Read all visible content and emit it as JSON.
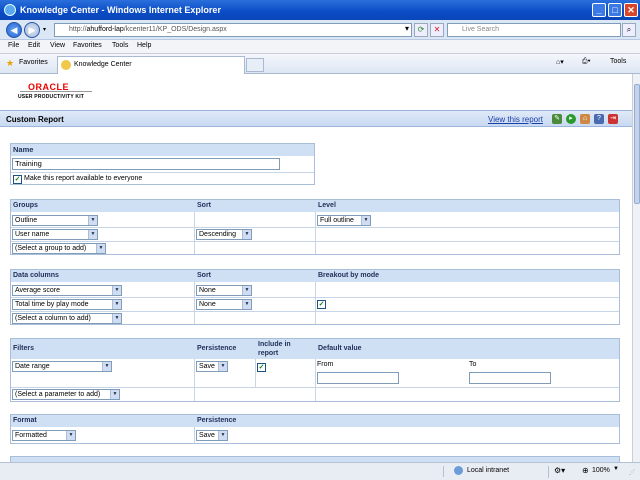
{
  "window": {
    "title": "Knowledge Center - Windows Internet Explorer"
  },
  "address": {
    "prefix": "http://",
    "host": "ahufford-lap",
    "path": "/kcenter11/KP_ODS/Design.aspx",
    "search_placeholder": "Live Search"
  },
  "menu": [
    "File",
    "Edit",
    "View",
    "Favorites",
    "Tools",
    "Help"
  ],
  "favorites": {
    "favorites_label": "Favorites",
    "tab_label": "Knowledge Center",
    "tools_label": "Tools"
  },
  "logo": {
    "top": "ORACLE",
    "bottom": "USER PRODUCTIVITY KIT"
  },
  "report": {
    "title": "Custom Report",
    "view_link": "View this report"
  },
  "name_section": {
    "header": "Name",
    "value": "Training",
    "share_label": "Make this report available to everyone",
    "shared": true
  },
  "groups_section": {
    "headers": {
      "groups": "Groups",
      "sort": "Sort",
      "level": "Level"
    },
    "rows": [
      {
        "group": "Outline",
        "sort": "",
        "level": "Full outline"
      },
      {
        "group": "User name",
        "sort": "Descending",
        "level": ""
      },
      {
        "group": "(Select a group to add)",
        "sort": "",
        "level": ""
      }
    ]
  },
  "columns_section": {
    "headers": {
      "columns": "Data columns",
      "sort": "Sort",
      "breakout": "Breakout by mode"
    },
    "rows": [
      {
        "column": "Average score",
        "sort": "None",
        "breakout": false
      },
      {
        "column": "Total time by play mode",
        "sort": "None",
        "breakout": true
      },
      {
        "column": "(Select a column to add)",
        "sort": "",
        "breakout": false
      }
    ]
  },
  "filters_section": {
    "headers": {
      "filters": "Filters",
      "persistence": "Persistence",
      "include": "Include in report",
      "default": "Default value"
    },
    "rows": [
      {
        "filter": "Date range",
        "persistence": "Save",
        "include": true,
        "from_label": "From",
        "to_label": "To"
      },
      {
        "filter": "(Select a parameter to add)"
      }
    ]
  },
  "format_section": {
    "headers": {
      "format": "Format",
      "persistence": "Persistence"
    },
    "format_value": "Formatted",
    "persistence_value": "Save"
  },
  "status": {
    "zone": "Local intranet",
    "zoom": "100%"
  }
}
